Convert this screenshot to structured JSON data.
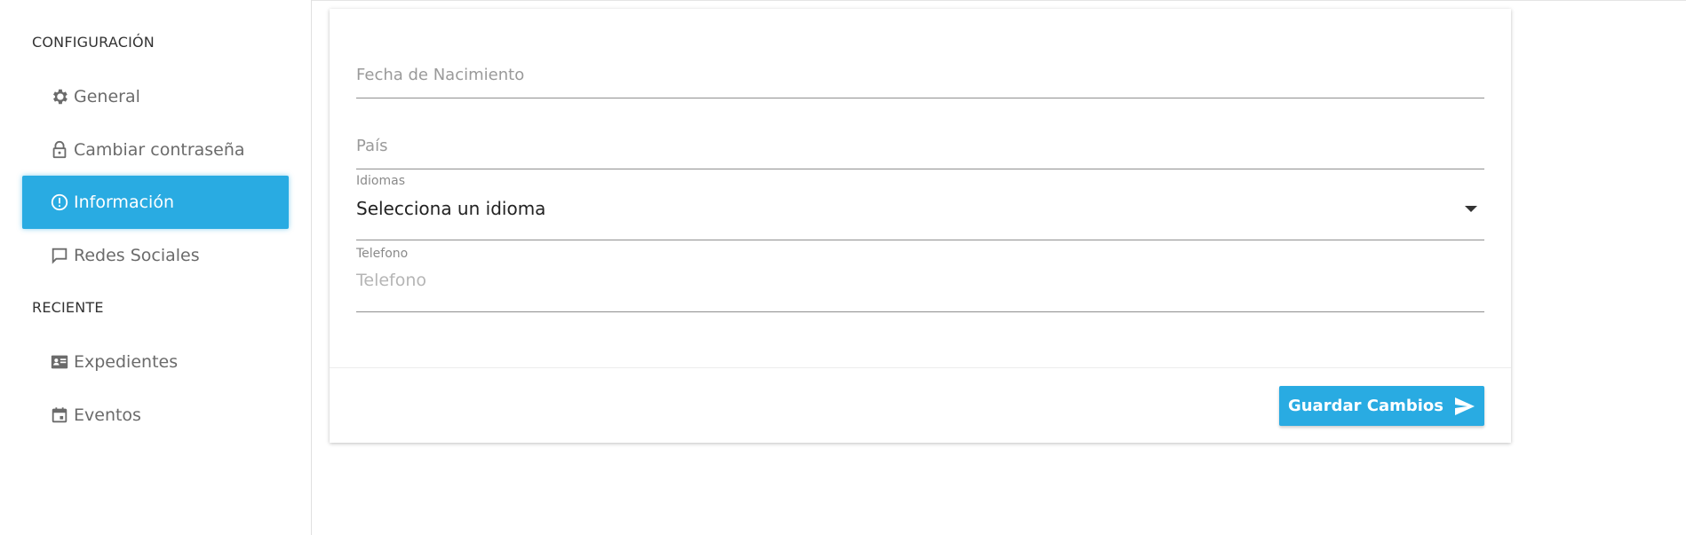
{
  "sidebar": {
    "sections": [
      {
        "title": "CONFIGURACIÓN",
        "items": [
          {
            "label": "General",
            "icon": "gear-icon"
          },
          {
            "label": "Cambiar contraseña",
            "icon": "lock-icon"
          },
          {
            "label": "Información",
            "icon": "info-icon",
            "active": true
          },
          {
            "label": "Redes Sociales",
            "icon": "chat-icon"
          }
        ]
      },
      {
        "title": "RECIENTE",
        "items": [
          {
            "label": "Expedientes",
            "icon": "id-card-icon"
          },
          {
            "label": "Eventos",
            "icon": "calendar-icon"
          }
        ]
      }
    ]
  },
  "form": {
    "birthdate": {
      "placeholder": "Fecha de Nacimiento"
    },
    "country": {
      "placeholder": "País"
    },
    "languages": {
      "label": "Idiomas",
      "selected": "Selecciona un idioma"
    },
    "phone": {
      "label": "Telefono",
      "placeholder": "Telefono"
    }
  },
  "actions": {
    "save_label": "Guardar Cambios",
    "save_icon": "send-icon"
  },
  "colors": {
    "accent": "#29abe2",
    "text_muted": "#6b6b6b"
  }
}
